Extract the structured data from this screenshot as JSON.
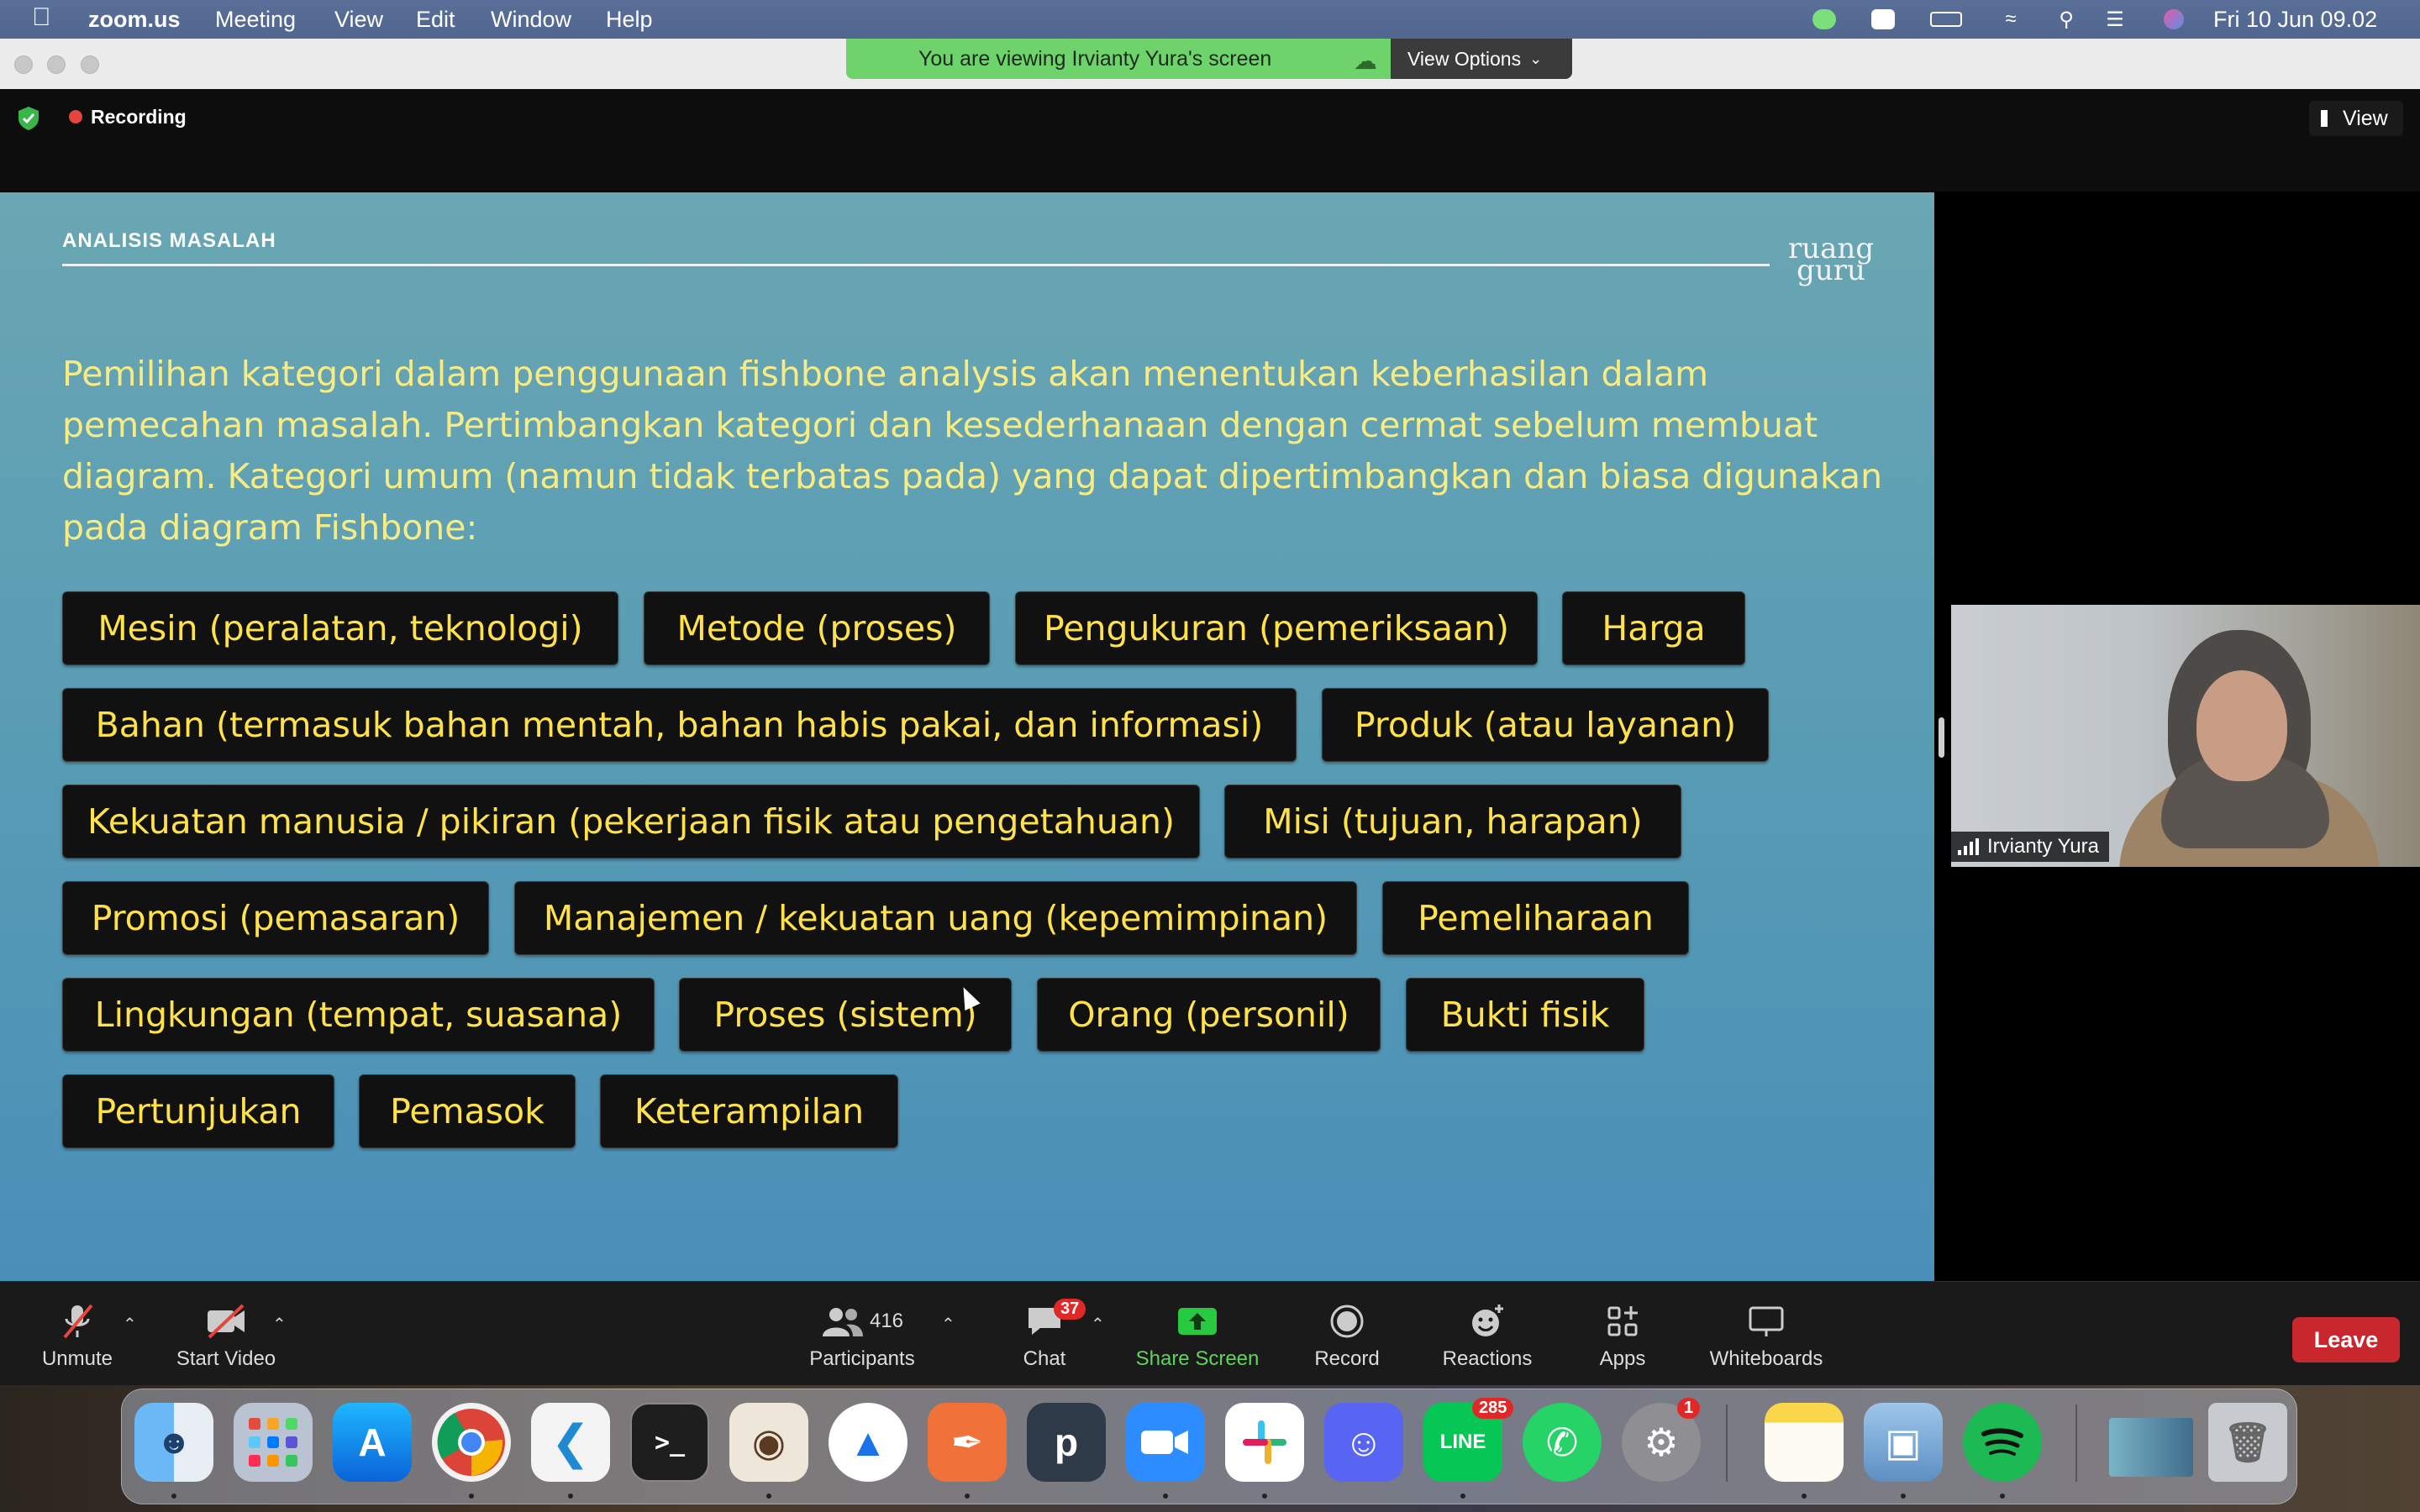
{
  "menubar": {
    "app_name": "zoom.us",
    "items": [
      "Meeting",
      "View",
      "Edit",
      "Window",
      "Help"
    ],
    "datetime": "Fri 10 Jun  09.02",
    "tray_icons": [
      "line-icon",
      "zoom-icon",
      "battery-icon",
      "wifi-icon",
      "search-icon",
      "control-center-icon",
      "siri-icon"
    ]
  },
  "share_banner": {
    "text": "You are viewing Irvianty Yura's screen",
    "view_options": "View Options"
  },
  "meeting_header": {
    "recording_label": "Recording",
    "view_label": "View"
  },
  "slide": {
    "header": "ANALISIS MASALAH",
    "logo_line1": "ruang",
    "logo_line2": "guru",
    "body": "Pemilihan kategori dalam penggunaan fishbone analysis akan menentukan keberhasilan dalam pemecahan masalah. Pertimbangkan kategori dan kesederhanaan dengan cermat sebelum membuat diagram. Kategori umum (namun tidak terbatas pada) yang dapat dipertimbangkan dan biasa digunakan pada diagram Fishbone:",
    "categories": [
      "Mesin (peralatan, teknologi)",
      "Metode (proses)",
      "Pengukuran (pemeriksaan)",
      "Harga",
      "Bahan (termasuk bahan mentah, bahan habis pakai, dan informasi)",
      "Produk (atau layanan)",
      "Kekuatan manusia / pikiran (pekerjaan fisik atau pengetahuan)",
      "Misi (tujuan, harapan)",
      "Promosi (pemasaran)",
      "Manajemen / kekuatan uang (kepemimpinan)",
      "Pemeliharaan",
      "Lingkungan (tempat, suasana)",
      "Proses (sistem)",
      "Orang (personil)",
      "Bukti fisik",
      "Pertunjukan",
      "Pemasok",
      "Keterampilan"
    ]
  },
  "participant_video": {
    "name": "Irvianty Yura"
  },
  "toolbar": {
    "unmute": "Unmute",
    "start_video": "Start Video",
    "participants_count": "416",
    "participants": "Participants",
    "chat": "Chat",
    "chat_badge": "37",
    "share_screen": "Share Screen",
    "record": "Record",
    "reactions": "Reactions",
    "apps": "Apps",
    "whiteboards": "Whiteboards",
    "leave": "Leave"
  },
  "dock": {
    "apps": [
      "Finder",
      "Launchpad",
      "App Store",
      "Chrome",
      "VS Code",
      "Terminal",
      "Sequel Ace",
      "Google Drive",
      "Instruments",
      "Postman",
      "Pinterest",
      "Zoom",
      "Slack",
      "Discord",
      "LINE",
      "WhatsApp",
      "System Preferences",
      "Notes",
      "Preview",
      "Spotify",
      "Screenshot",
      "Trash"
    ],
    "line_badge": "285",
    "settings_badge": "1"
  },
  "colors": {
    "slide_text": "#f6ec83",
    "chip_text": "#ffe24a",
    "banner_green": "#6fd36b",
    "leave_red": "#c8272d",
    "share_green": "#27c93f"
  }
}
